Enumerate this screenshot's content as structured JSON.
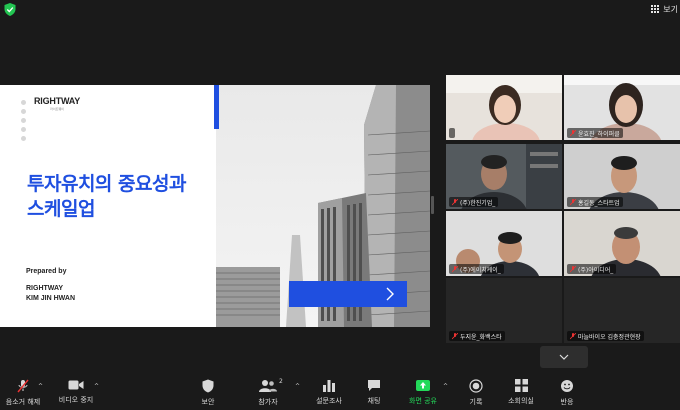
{
  "top_bar": {
    "security_icon": "green-shield-icon",
    "view_label": "보기"
  },
  "slide": {
    "logo_text": "RIGHTWAY",
    "logo_subtext": "라이트웨이",
    "title_line1": "투자유치의 중요성과",
    "title_line2": "스케일업",
    "prepared_by": "Prepared by",
    "company": "RIGHTWAY",
    "presenter": "KIM JIN HWAN",
    "accent_color": "#1f4fe0"
  },
  "participants": [
    {
      "name": "",
      "active_speaker": true
    },
    {
      "name": "윤효진_하이퍼클"
    },
    {
      "name": "(주)한진기업_"
    },
    {
      "name": "홍길동_스타트업"
    },
    {
      "name": "(주)에이치케이_"
    },
    {
      "name": "(주)아이디어_"
    },
    {
      "name": "두지윤_화백스타"
    },
    {
      "name": "마늘바이오 김충정관현장"
    }
  ],
  "toolbar": {
    "unmute_label": "음소거 해제",
    "video_label": "비디오 중지",
    "security_label": "보안",
    "participants_label": "참가자",
    "participants_count": "2",
    "polls_label": "설문조사",
    "chat_label": "채팅",
    "share_label": "화면 공유",
    "record_label": "기록",
    "breakout_label": "소회의실",
    "reactions_label": "반응",
    "share_color": "#23d959"
  }
}
